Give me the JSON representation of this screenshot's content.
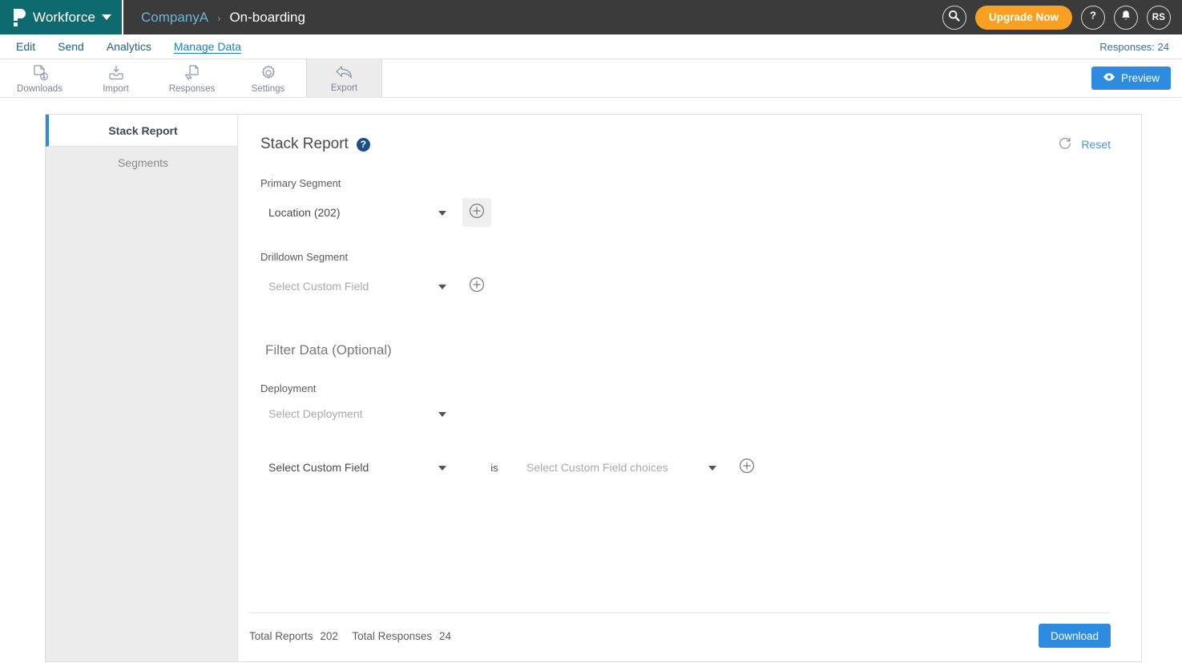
{
  "header": {
    "logo_glyph": "P",
    "brand": "Workforce",
    "breadcrumb_company": "CompanyA",
    "breadcrumb_separator": "›",
    "breadcrumb_current": "On-boarding",
    "upgrade_label": "Upgrade Now",
    "avatar_initials": "RS",
    "brand_color": "#0d6a6e",
    "upgrade_color": "#f7a021"
  },
  "nav": {
    "items": [
      {
        "label": "Edit",
        "active": false
      },
      {
        "label": "Send",
        "active": false
      },
      {
        "label": "Analytics",
        "active": false
      },
      {
        "label": "Manage Data",
        "active": true
      }
    ],
    "responses_label": "Responses: 24"
  },
  "toolbar": {
    "items": [
      {
        "label": "Downloads",
        "icon": "file-download-icon",
        "active": false
      },
      {
        "label": "Import",
        "icon": "inbox-import-icon",
        "active": false
      },
      {
        "label": "Responses",
        "icon": "hand-document-icon",
        "active": false
      },
      {
        "label": "Settings",
        "icon": "gear-icon",
        "active": false
      },
      {
        "label": "Export",
        "icon": "reply-arrow-icon",
        "active": true
      }
    ],
    "preview_label": "Preview",
    "preview_icon": "eye-icon",
    "preview_color": "#2d8cdf"
  },
  "sidebar": {
    "items": [
      {
        "label": "Stack Report",
        "active": true
      },
      {
        "label": "Segments",
        "active": false
      }
    ],
    "accent_color": "#2d8cdf"
  },
  "main": {
    "title": "Stack Report",
    "help_icon": "question-mark-icon",
    "reset_label": "Reset",
    "reset_icon": "refresh-icon",
    "primary_segment": {
      "label": "Primary Segment",
      "value": "Location (202)",
      "add_icon": "plus-circle-icon"
    },
    "drilldown_segment": {
      "label": "Drilldown Segment",
      "placeholder": "Select Custom Field",
      "add_icon": "plus-circle-icon"
    },
    "filter": {
      "section_title": "Filter Data (Optional)",
      "deployment_label": "Deployment",
      "deployment_placeholder": "Select Deployment",
      "custom_field_placeholder": "Select Custom Field",
      "operator": "is",
      "choices_placeholder": "Select Custom Field choices",
      "add_icon": "plus-circle-icon"
    },
    "footer": {
      "total_reports_label": "Total Reports",
      "total_reports_value": "202",
      "total_responses_label": "Total Responses",
      "total_responses_value": "24",
      "download_label": "Download"
    }
  }
}
